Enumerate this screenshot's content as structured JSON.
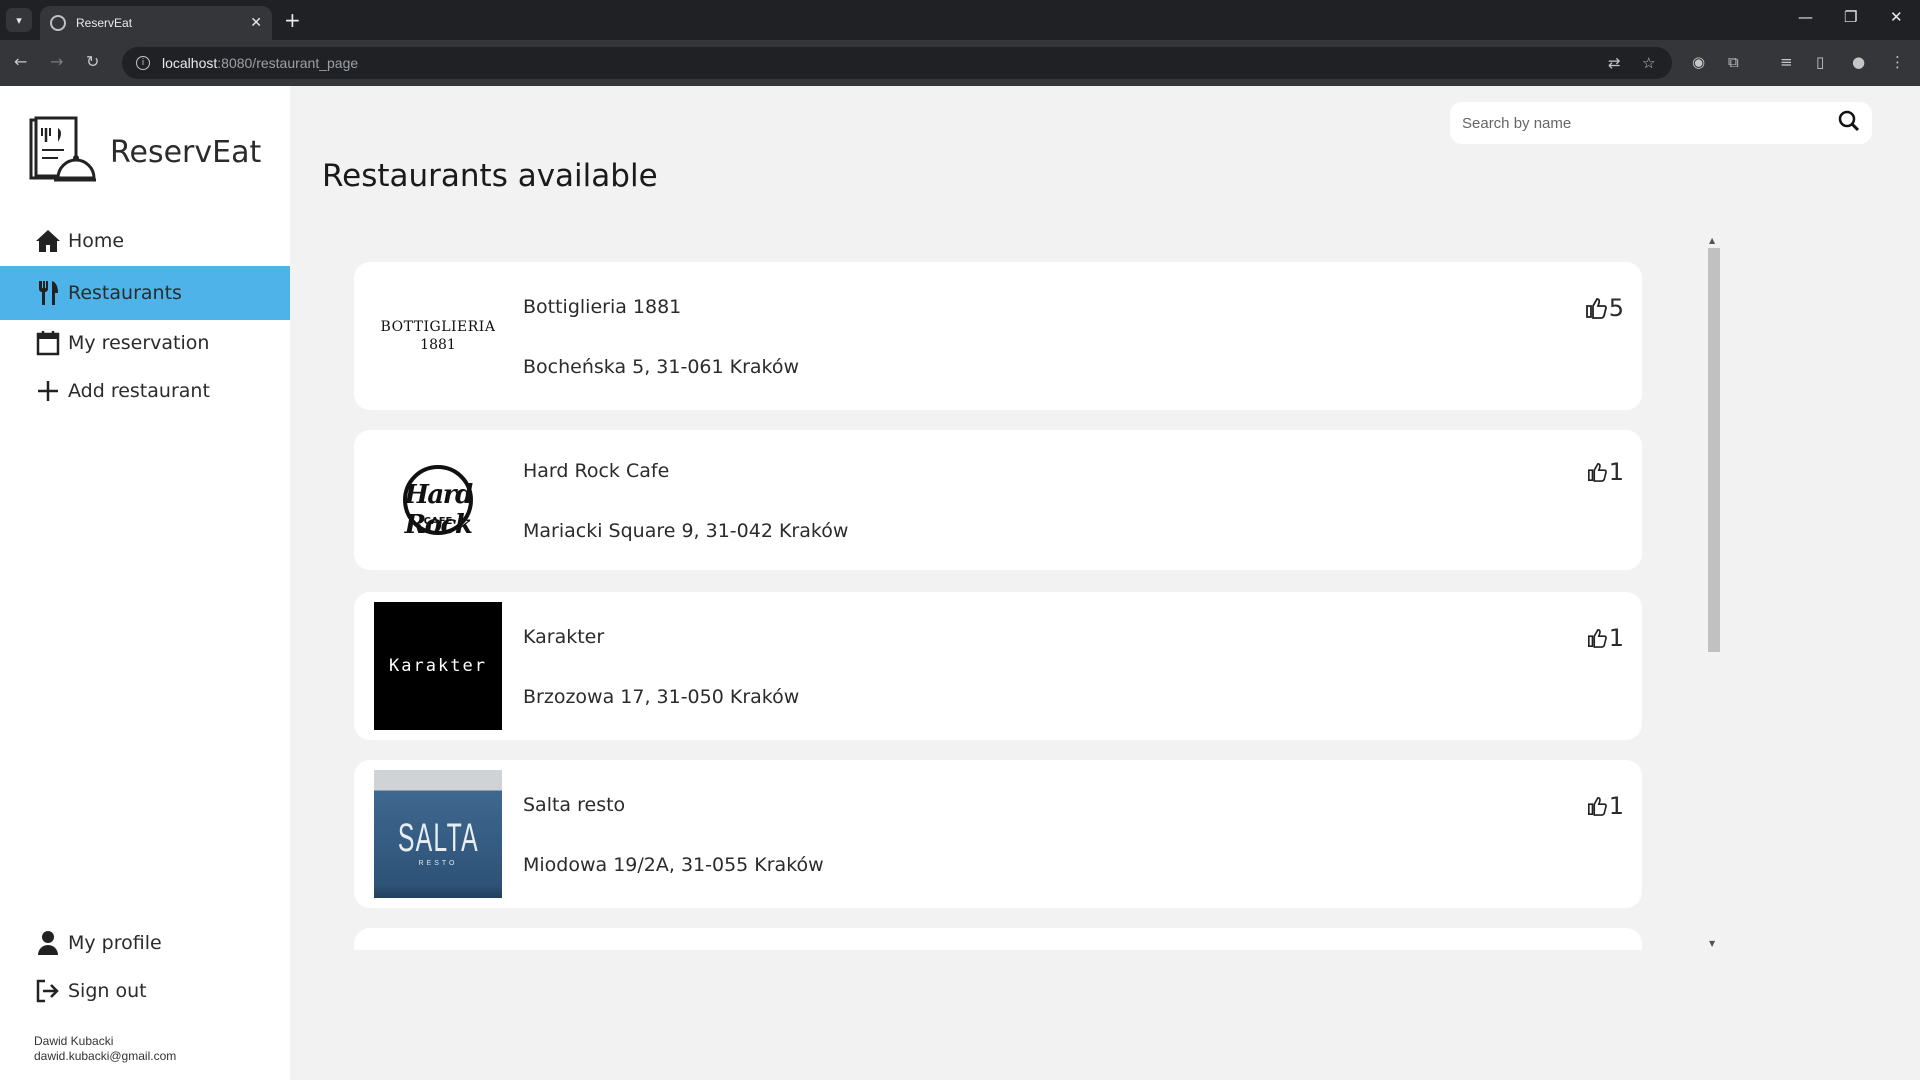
{
  "browser": {
    "tab_title": "ReservEat",
    "url_host": "localhost",
    "url_rest": ":8080/restaurant_page"
  },
  "app": {
    "brand": "ReservEat",
    "nav": [
      {
        "label": "Home",
        "icon": "home-icon",
        "active": false
      },
      {
        "label": "Restaurants",
        "icon": "utensils-icon",
        "active": true
      },
      {
        "label": "My reservation",
        "icon": "calendar-icon",
        "active": false
      },
      {
        "label": "Add restaurant",
        "icon": "plus-icon",
        "active": false
      }
    ],
    "bottom_nav": [
      {
        "label": "My profile",
        "icon": "user-icon"
      },
      {
        "label": "Sign out",
        "icon": "sign-out-icon"
      }
    ],
    "user": {
      "name": "Dawid Kubacki",
      "email": "dawid.kubacki@gmail.com"
    },
    "accent_color": "#4eb3e8"
  },
  "main": {
    "title": "Restaurants available",
    "search_placeholder": "Search by name"
  },
  "restaurants": [
    {
      "name": "Bottiglieria 1881",
      "address": "Bocheńska 5, 31-061 Kraków",
      "likes": "5",
      "logo_text_1": "BOTTIGLIERIA",
      "logo_text_2": "1881"
    },
    {
      "name": "Hard Rock Cafe",
      "address": "Mariacki Square 9, 31-042 Kraków",
      "likes": "1",
      "logo_text_1": "Hard Rock",
      "logo_text_2": "CAFE"
    },
    {
      "name": "Karakter",
      "address": "Brzozowa 17, 31-050 Kraków",
      "likes": "1",
      "logo_text_1": "Karakter"
    },
    {
      "name": "Salta resto",
      "address": "Miodowa 19/2A, 31-055 Kraków",
      "likes": "1",
      "logo_text_1": "SALTA",
      "logo_text_2": "RESTO"
    }
  ]
}
